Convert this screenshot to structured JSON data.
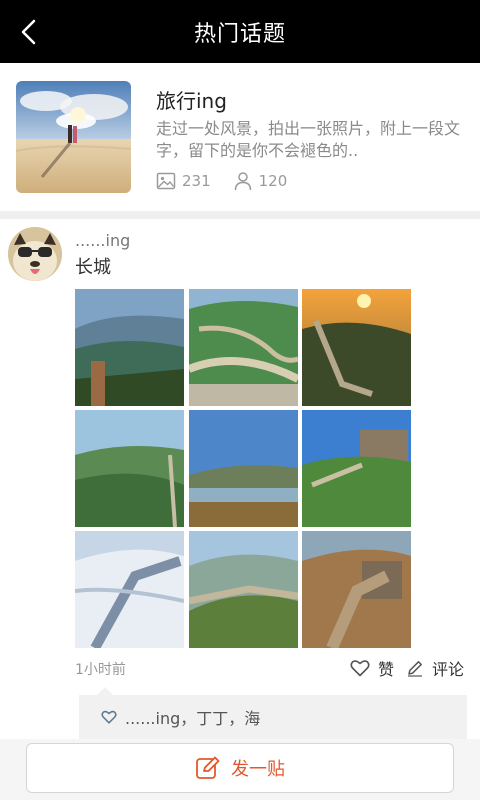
{
  "header": {
    "title": "热门话题"
  },
  "topic": {
    "title": "旅行ing",
    "description": "走过一处风景，拍出一张照片，附上一段文字，留下的是你不会褪色的..",
    "photo_count": "231",
    "member_count": "120"
  },
  "post": {
    "username": "......ing",
    "text": "长城",
    "time": "1小时前",
    "like_label": "赞",
    "comment_label": "评论",
    "likers": "......ing，丁丁，海"
  },
  "bottom": {
    "post_button_label": "发一贴"
  },
  "colors": {
    "header_bg": "#000000",
    "accent": "#e4572e"
  },
  "icons": {
    "back": "chevron-left-icon",
    "photos": "image-icon",
    "members": "user-icon",
    "like": "heart-icon",
    "comment": "pencil-icon",
    "compose": "compose-icon"
  }
}
